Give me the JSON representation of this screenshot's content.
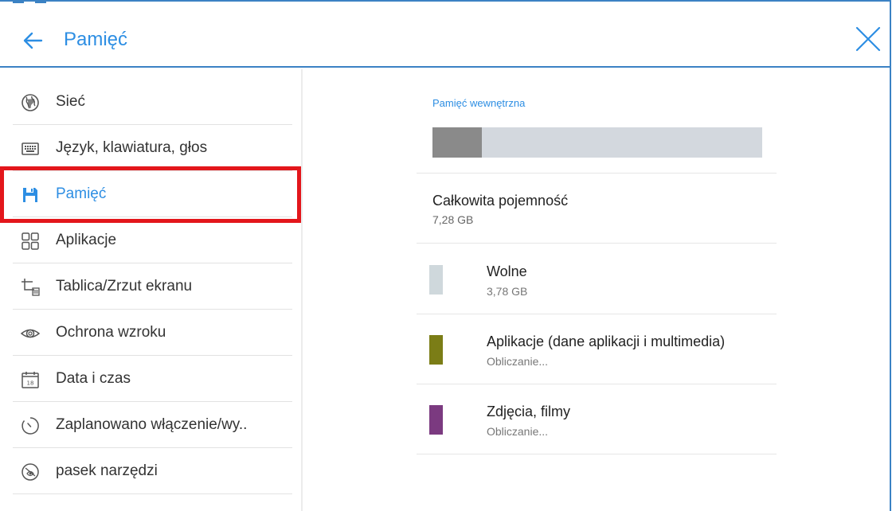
{
  "header": {
    "title": "Pamięć",
    "back_icon": "arrow-left-icon",
    "close_icon": "close-icon"
  },
  "sidebar": {
    "active_index": 2,
    "items": [
      {
        "label": "Sieć",
        "icon": "globe-icon"
      },
      {
        "label": "Język, klawiatura, głos",
        "icon": "keyboard-icon"
      },
      {
        "label": "Pamięć",
        "icon": "floppy-disk-icon"
      },
      {
        "label": "Aplikacje",
        "icon": "apps-grid-icon"
      },
      {
        "label": "Tablica/Zrzut ekranu",
        "icon": "crop-screenshot-icon"
      },
      {
        "label": "Ochrona wzroku",
        "icon": "eye-icon"
      },
      {
        "label": "Data i czas",
        "icon": "calendar-icon"
      },
      {
        "label": "Zaplanowano włączenie/wy..",
        "icon": "timer-icon"
      },
      {
        "label": "pasek narzędzi",
        "icon": "toolbar-icon"
      }
    ]
  },
  "storage": {
    "section_title": "Pamięć wewnętrzna",
    "used_fraction": 0.15,
    "total_label": "Całkowita pojemność",
    "total_value": "7,28 GB",
    "categories": [
      {
        "label": "Wolne",
        "value": "3,78 GB",
        "color": "#cfd8dc"
      },
      {
        "label": "Aplikacje (dane aplikacji i multimedia)",
        "value": "Obliczanie...",
        "color": "#7b7d16"
      },
      {
        "label": "Zdjęcia, filmy",
        "value": "Obliczanie...",
        "color": "#7b3a80"
      }
    ]
  },
  "colors": {
    "accent": "#2d8ee3",
    "highlight": "#e3161b",
    "used": "#8a8a8a"
  }
}
